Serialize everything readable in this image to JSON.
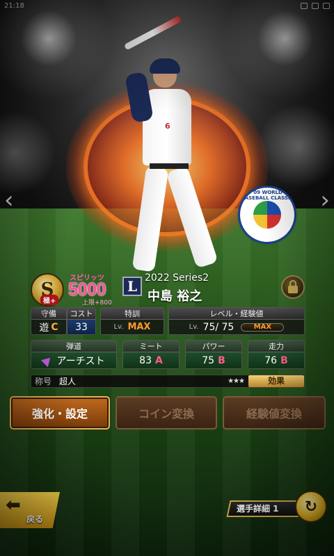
{
  "status_bar": {
    "time": "21:18",
    "icons": [
      "notification-icon",
      "wifi-icon",
      "battery-icon"
    ]
  },
  "player": {
    "series": "2022 Series2",
    "name": "中島 裕之",
    "uniform_number": "6",
    "team_logo": "L"
  },
  "rank": {
    "letter": "S",
    "sub": "極+"
  },
  "spirits": {
    "label": "スピリッツ",
    "value": "5000",
    "cap": "上限+800"
  },
  "wbc_logo_text": "'09 WORLD BASEBALL CLASSIC",
  "stats": {
    "position": {
      "label": "守備",
      "value": "遊",
      "grade": "C"
    },
    "cost": {
      "label": "コスト",
      "value": "33"
    },
    "special": {
      "label": "特訓",
      "lv": "Lv.",
      "value": "MAX"
    },
    "level": {
      "label": "レベル・経験値",
      "lv": "Lv.",
      "value": "75/ 75",
      "exp": "MAX"
    },
    "trajectory": {
      "label": "弾道",
      "value": "アーチスト"
    },
    "meet": {
      "label": "ミート",
      "value": "83",
      "grade": "A"
    },
    "power": {
      "label": "パワー",
      "value": "75",
      "grade": "B"
    },
    "speed": {
      "label": "走力",
      "value": "76",
      "grade": "B"
    }
  },
  "title_row": {
    "key": "称号",
    "value": "超人",
    "stars": "★★★",
    "effect_label": "効果"
  },
  "actions": {
    "enhance": "強化・設定",
    "coin": "コイン変換",
    "exp": "経験値変換"
  },
  "bottom": {
    "back": "戻る",
    "detail": "選手詳細 1"
  },
  "colors": {
    "accent_gold": "#d4b04a",
    "spirits_pink": "#ff4f9c",
    "field_green": "#2b5b1e"
  }
}
